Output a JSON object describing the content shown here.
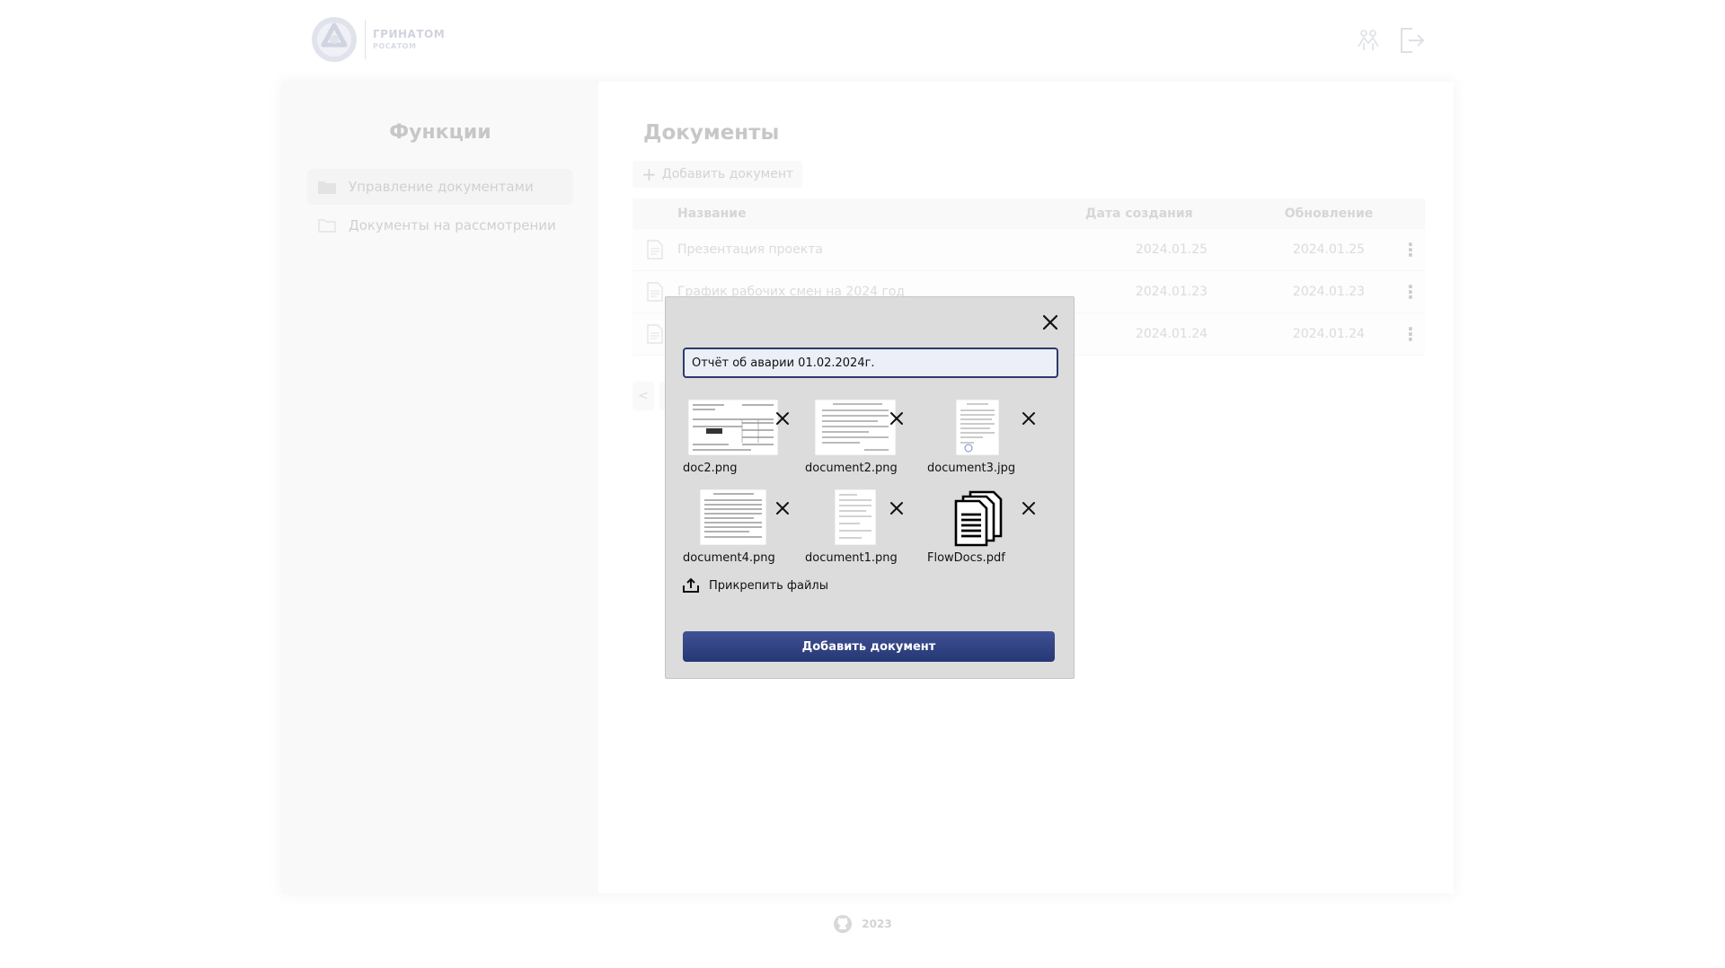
{
  "header": {
    "logo_title": "ГРИНАТОМ",
    "logo_subtitle": "РОСАТОМ",
    "icons": [
      "users-icon",
      "logout-icon"
    ]
  },
  "sidebar": {
    "title": "Функции",
    "items": [
      {
        "label": "Управление документами",
        "icon": "folder-filled-icon",
        "active": true
      },
      {
        "label": "Документы на рассмотрении",
        "icon": "folder-outline-icon",
        "active": false
      }
    ]
  },
  "content": {
    "title": "Документы",
    "add_button": "Добавить документ",
    "table": {
      "headers": {
        "name": "Название",
        "created": "Дата создания",
        "updated": "Обновление"
      },
      "rows": [
        {
          "name": "Презентация проекта",
          "created": "2024.01.25",
          "updated": "2024.01.25"
        },
        {
          "name": "График рабочих смен на 2024 год",
          "created": "2024.01.23",
          "updated": "2024.01.23"
        },
        {
          "name": "",
          "created": "2024.01.24",
          "updated": "2024.01.24"
        }
      ]
    },
    "pager_prev": "<"
  },
  "modal": {
    "title_value": "Отчёт об аварии 01.02.2024г.",
    "files": [
      {
        "name": "doc2.png"
      },
      {
        "name": "document2.png"
      },
      {
        "name": "document3.jpg"
      },
      {
        "name": "document4.png"
      },
      {
        "name": "document1.png"
      },
      {
        "name": "FlowDocs.pdf"
      }
    ],
    "attach_label": "Прикрепить файлы",
    "submit_label": "Добавить документ"
  },
  "footer": {
    "year": "2023",
    "icon": "github-icon"
  },
  "colors": {
    "primary": "#2e3d7a",
    "modal_bg": "#dcdcdc",
    "sidebar_bg": "#f5f5f5"
  }
}
